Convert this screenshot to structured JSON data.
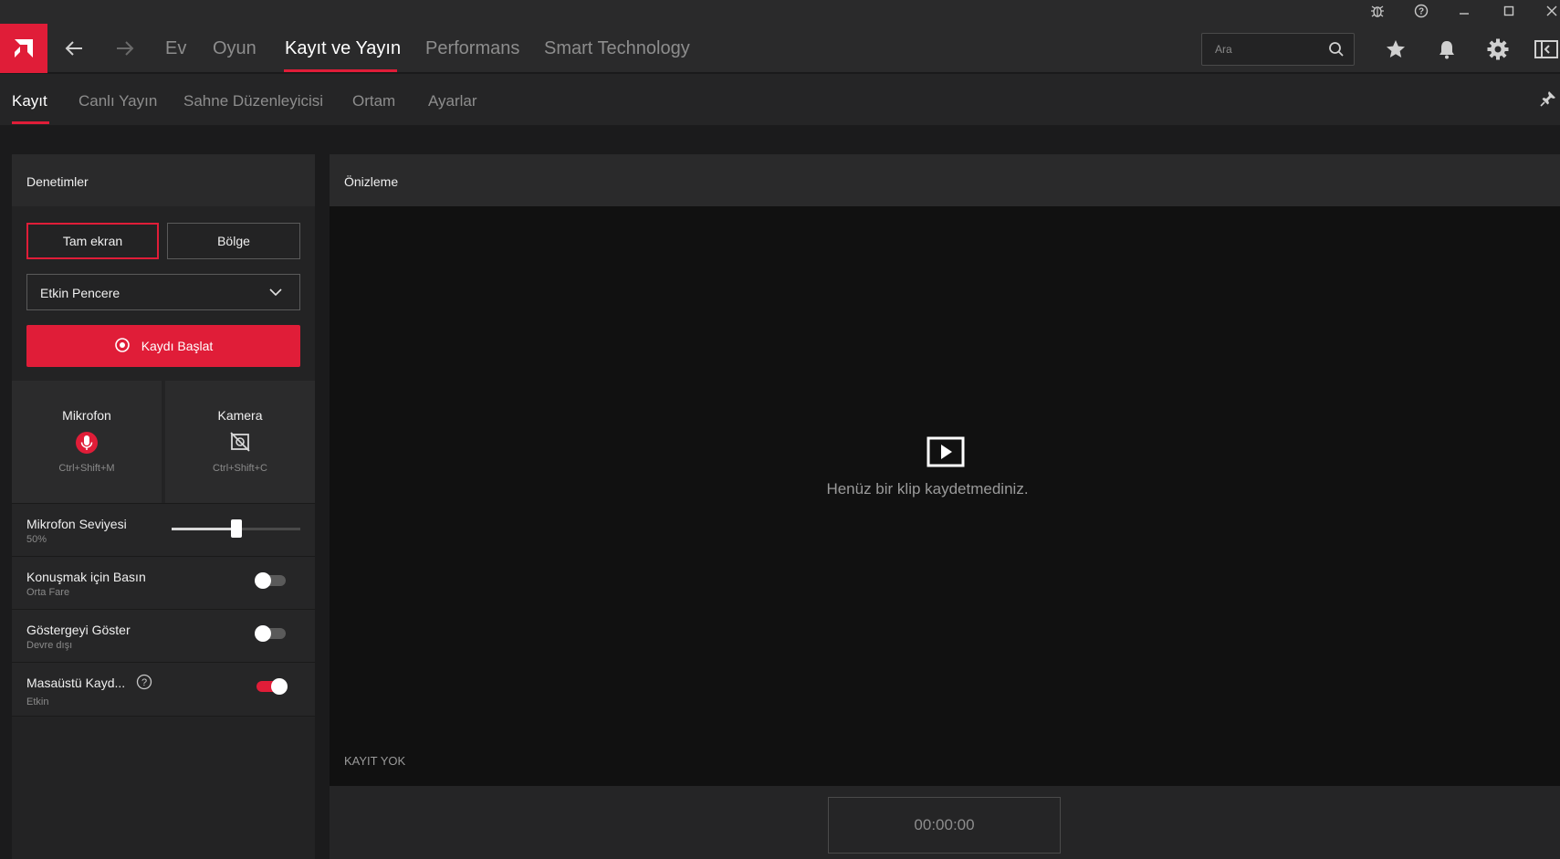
{
  "window": {
    "controls": [
      "bug-icon",
      "help-icon",
      "minimize-icon",
      "maximize-icon",
      "close-icon"
    ]
  },
  "nav": {
    "logo": "amd-logo",
    "items": [
      {
        "label": "Ev"
      },
      {
        "label": "Oyun"
      },
      {
        "label": "Kayıt ve Yayın"
      },
      {
        "label": "Performans"
      },
      {
        "label": "Smart Technology"
      }
    ],
    "active": "Kayıt ve Yayın",
    "search_placeholder": "Ara"
  },
  "subnav": {
    "items": [
      {
        "label": "Kayıt"
      },
      {
        "label": "Canlı Yayın"
      },
      {
        "label": "Sahne Düzenleyicisi"
      },
      {
        "label": "Ortam"
      },
      {
        "label": "Ayarlar"
      }
    ],
    "active": "Kayıt"
  },
  "controls_panel": {
    "title": "Denetimler",
    "mode_fullscreen": "Tam ekran",
    "mode_region": "Bölge",
    "source_selected": "Etkin Pencere",
    "start_label": "Kaydı Başlat",
    "mic": {
      "label": "Mikrofon",
      "shortcut": "Ctrl+Shift+M",
      "icon": "microphone-icon"
    },
    "camera": {
      "label": "Kamera",
      "shortcut": "Ctrl+Shift+C",
      "icon": "camera-off-icon"
    },
    "mic_level": {
      "label": "Mikrofon Seviyesi",
      "value": "50%",
      "fraction": 0.5
    },
    "push_to_talk": {
      "label": "Konuşmak için Basın",
      "sub": "Orta Fare",
      "enabled": false
    },
    "show_indicator": {
      "label": "Göstergeyi Göster",
      "sub": "Devre dışı",
      "enabled": false
    },
    "desktop_record": {
      "label": "Masaüstü Kayd...",
      "sub": "Etkin",
      "enabled": true
    }
  },
  "preview": {
    "title": "Önizleme",
    "empty_message": "Henüz bir klip kaydetmediniz.",
    "status": "KAYIT YOK",
    "timer": "00:00:00"
  },
  "colors": {
    "accent": "#e01d38"
  }
}
